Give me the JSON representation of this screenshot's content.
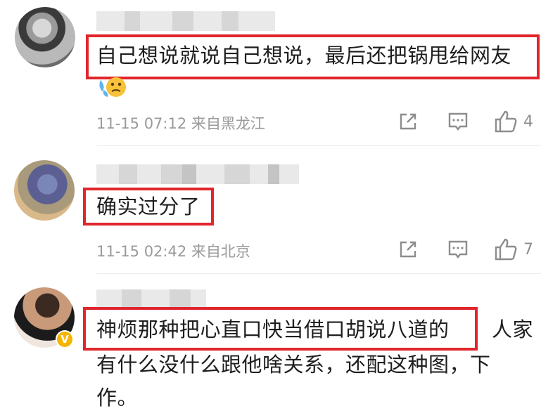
{
  "comments": [
    {
      "text": "自己想说就说自己想说，最后还把锅甩给网友",
      "emoji": "crying-face-emoji",
      "time": "11-15 07:12",
      "location": "来自黑龙江",
      "likes": "4"
    },
    {
      "text": "确实过分了",
      "time": "11-15 02:42",
      "location": "来自北京",
      "likes": "7"
    },
    {
      "text_highlighted": "神烦那种把心直口快当借口胡说八道的",
      "text_rest_line1": "人家",
      "text_line2": "有什么没什么跟他啥关系，还配这种图，下",
      "text_line3": "作。",
      "verified_badge": "V"
    }
  ],
  "colors": {
    "highlight": "#e0262c",
    "meta_text": "#9a9a9a",
    "verified": "#f5b400"
  }
}
